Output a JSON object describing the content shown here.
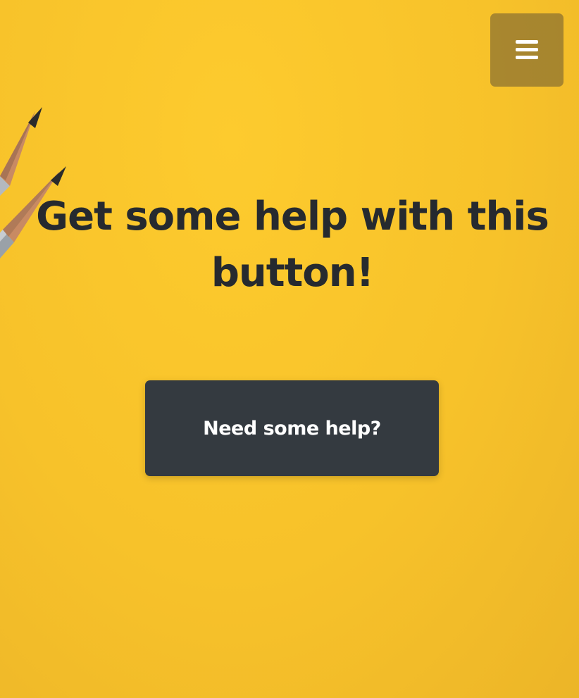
{
  "header": {
    "menu_icon": "hamburger-menu-icon"
  },
  "hero": {
    "headline": "Get some help with this button!",
    "background_color": "#f7c22a",
    "decoration_icon": "pencils-image"
  },
  "cta": {
    "button_label": "Need some help?",
    "button_color": "#343a40",
    "label_color": "#ffffff"
  },
  "colors": {
    "text_dark": "#262a2f",
    "menu_bg": "#7c6530"
  }
}
